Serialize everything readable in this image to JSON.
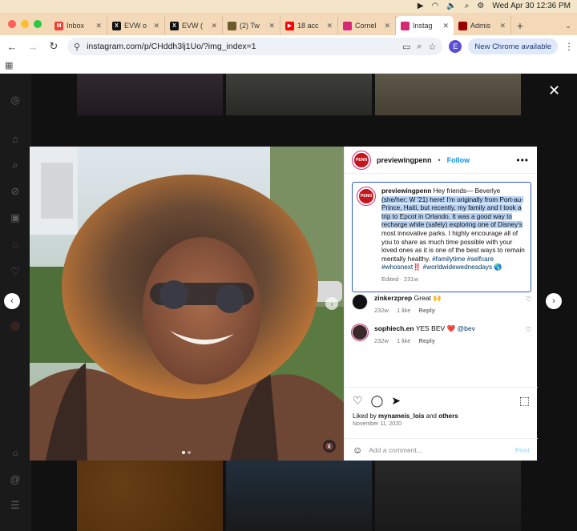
{
  "menubar": {
    "datetime": "Wed Apr 30  12:36 PM"
  },
  "tabs": [
    {
      "label": "Inbox",
      "favicon_color": "#ea4335",
      "favicon_char": "M"
    },
    {
      "label": "EVW o",
      "favicon_color": "#111111",
      "favicon_char": "X"
    },
    {
      "label": "EVW (",
      "favicon_color": "#111111",
      "favicon_char": "X"
    },
    {
      "label": "(2) Tw",
      "favicon_color": "#6b5a2a",
      "favicon_char": ""
    },
    {
      "label": "18 acc",
      "favicon_color": "#ff0000",
      "favicon_char": "▶"
    },
    {
      "label": "Cornel",
      "favicon_color": "#d62976",
      "favicon_char": ""
    },
    {
      "label": "Instag",
      "favicon_color": "#d62976",
      "favicon_char": "",
      "active": true
    },
    {
      "label": "Admis",
      "favicon_color": "#990000",
      "favicon_char": ""
    }
  ],
  "browser": {
    "url": "instagram.com/p/CHddh3lj1Uo/?img_index=1",
    "profile_initial": "E",
    "new_chrome_label": "New Chrome available"
  },
  "post": {
    "username": "previewingpenn",
    "follow_label": "Follow",
    "pfp_text": "PENN",
    "caption": {
      "plain_start": "Hey friends— Beverlye ",
      "highlighted": "(she/her; W '21) here! I'm originally from Port-au-Prince, Haiti, but recently, my family and I took a trip to Epcot in Orlando. It was a good way to recharge while (safely) exploring one of Disney's",
      "plain_end": " most innovative parks. I highly encourage all of you to share as much time possible with your loved ones as it is one of the best ways to remain mentally healthy. ",
      "hashtags": "#familytime #selfcare #whosnext",
      "hashtags_end": "#worldwidewednesdays",
      "edited_label": "Edited · 231w"
    },
    "comments": [
      {
        "username": "zinkerzprep",
        "text": "Great 🙌",
        "time": "232w",
        "likes": "1 like",
        "reply": "Reply",
        "pfp_color": "#111111"
      },
      {
        "username": "sophiech.en",
        "text": "YES BEV ❤️ ",
        "mention": "@bev",
        "time": "232w",
        "likes": "1 like",
        "reply": "Reply",
        "pfp_color": "#3a2a2a"
      }
    ],
    "liked_by_prefix": "Liked by ",
    "liked_by_user": "mynameis_lois",
    "liked_by_mid": " and ",
    "liked_by_others": "others",
    "date": "November 11, 2020",
    "comment_placeholder": "Add a comment...",
    "post_label": "Post"
  },
  "colors": {
    "ig_blue": "#0095f6",
    "selection": "#b8d3f5",
    "focus_border": "#2e5fbf"
  }
}
